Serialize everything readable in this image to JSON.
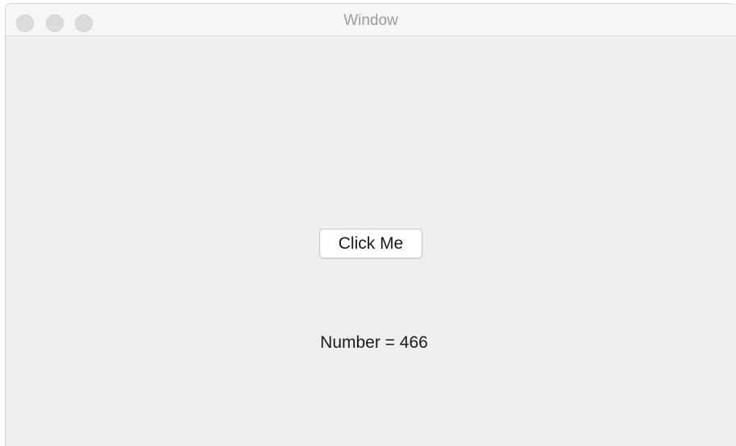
{
  "window": {
    "title": "Window"
  },
  "main": {
    "button_label": "Click Me",
    "number_text": "Number = 466"
  },
  "colors": {
    "window_bg": "#efefef",
    "titlebar_bg": "#f6f6f6",
    "traffic_light": "#dcdcdc",
    "title_text": "#9b9b9b"
  },
  "icons": {
    "close": "close-traffic-light-icon",
    "minimize": "minimize-traffic-light-icon",
    "zoom": "zoom-traffic-light-icon"
  }
}
